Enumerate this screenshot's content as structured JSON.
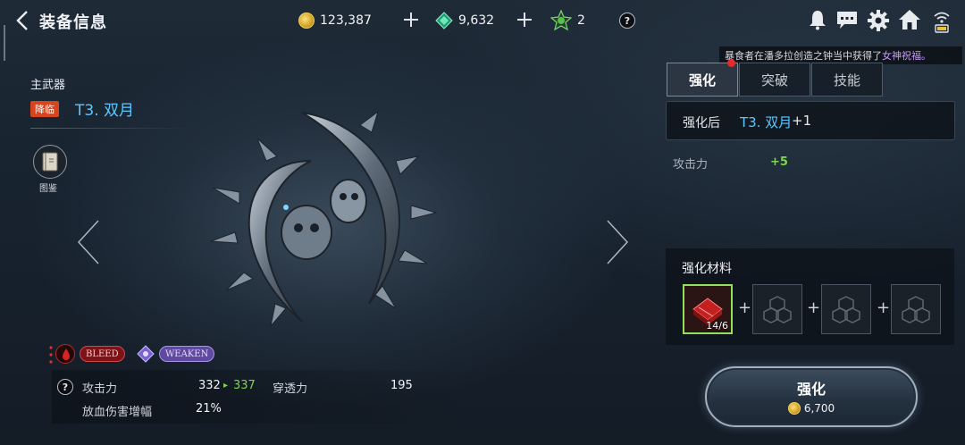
{
  "header": {
    "title": "装备信息",
    "gold": "123,387",
    "diamonds": "9,632",
    "tickets": "2",
    "help_mark": "?"
  },
  "ticker": {
    "prefix": "暴食者在潘多拉创造之钟当中获得了",
    "highlight": "女神祝福。"
  },
  "item": {
    "slot": "主武器",
    "badge": "降临",
    "name": "T3. 双月",
    "codex_label": "图鉴"
  },
  "effects": {
    "tags": [
      "BLEED",
      "WEAKEN"
    ]
  },
  "stats": {
    "help_mark": "?",
    "attack_label": "攻击力",
    "attack_value": "332",
    "attack_arrow": "▸",
    "attack_new": "337",
    "pierce_label": "穿透力",
    "pierce_value": "195",
    "bleed_label": "放血伤害增幅",
    "bleed_value": "21%"
  },
  "tabs": [
    "强化",
    "突破",
    "技能"
  ],
  "enhance": {
    "after_label": "强化后",
    "after_name": "T3. 双月",
    "after_suffix": "+1",
    "stat_label": "攻击力",
    "stat_delta": "+5",
    "materials_title": "强化材料",
    "material_count": "14/6",
    "button_label": "强化",
    "cost": "6,700"
  },
  "colors": {
    "name_blue": "#5fc7ff",
    "green": "#7dd64b",
    "badge_red": "#d8451c"
  }
}
